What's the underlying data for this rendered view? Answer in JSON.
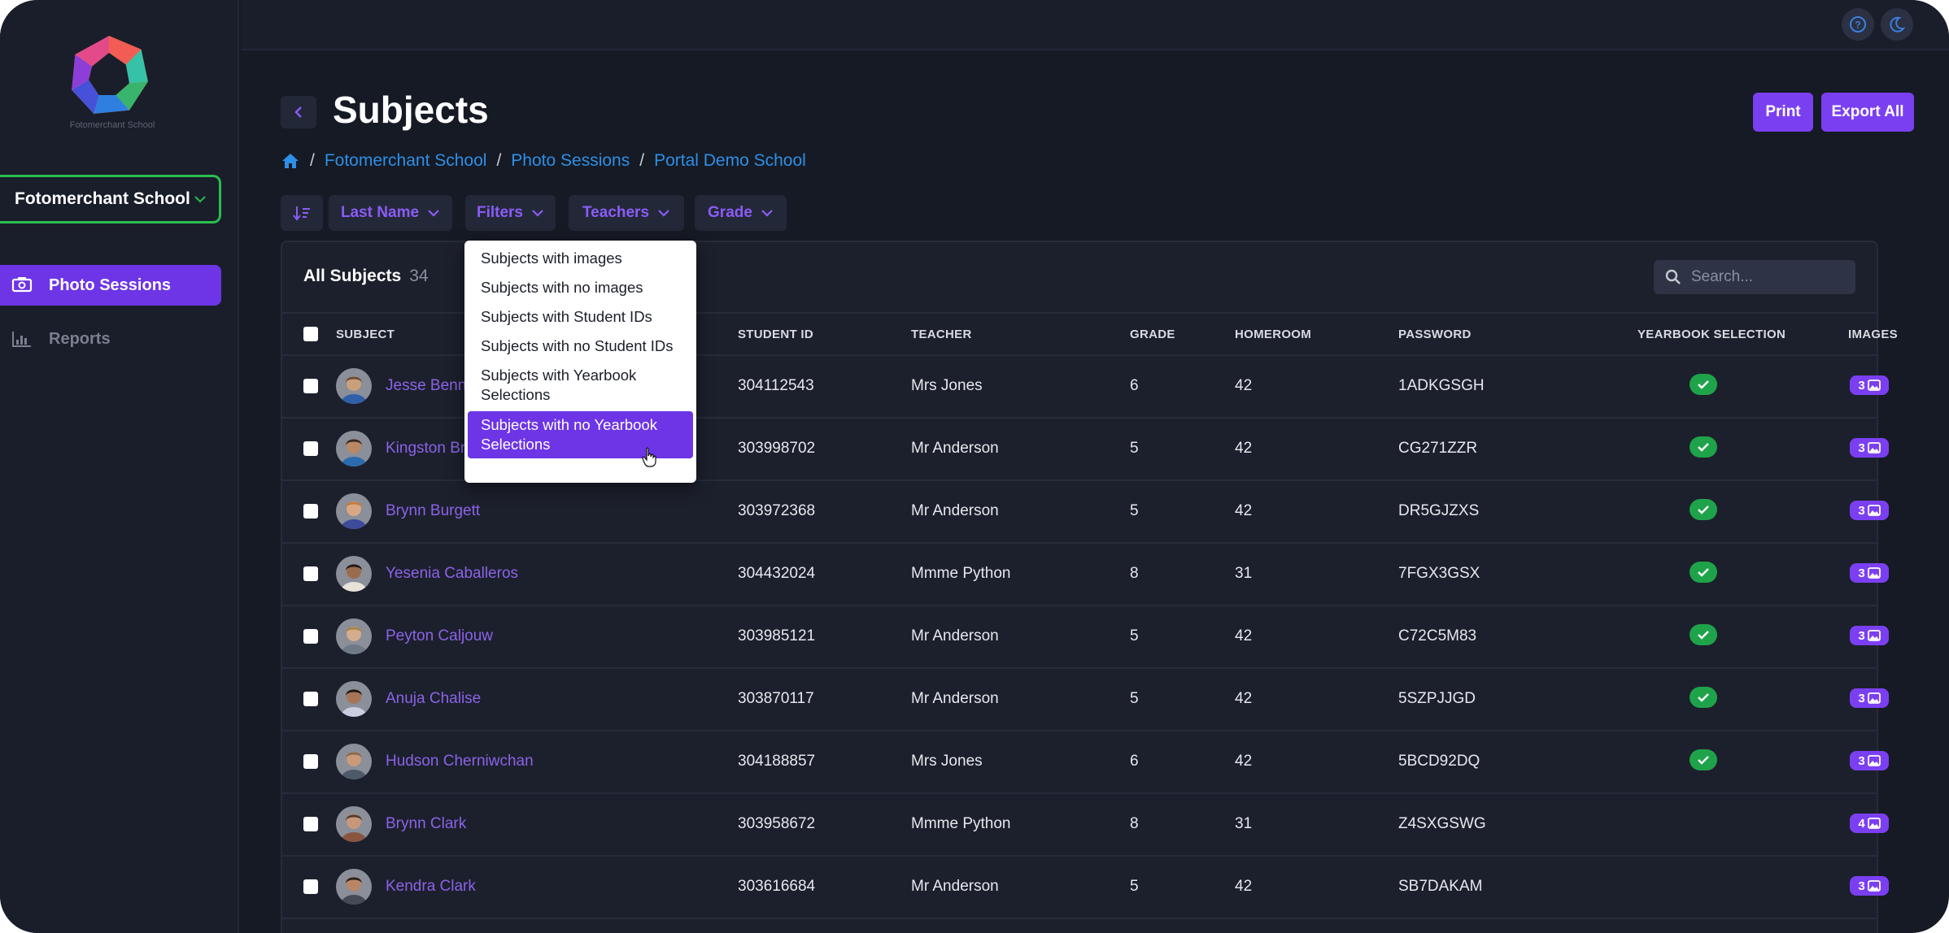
{
  "app": {
    "logo_text": "Fotomerchant School",
    "school_select": "Fotomerchant School"
  },
  "sidebar": {
    "items": [
      {
        "label": "Photo Sessions",
        "icon": "camera-icon",
        "active": true
      },
      {
        "label": "Reports",
        "icon": "bar-chart-icon",
        "active": false
      }
    ]
  },
  "topbar": {
    "help_icon": "help-icon",
    "theme_icon": "moon-icon"
  },
  "header": {
    "title": "Subjects",
    "print_label": "Print",
    "export_label": "Export All"
  },
  "breadcrumb": [
    "Fotomerchant School",
    "Photo Sessions",
    "Portal Demo School"
  ],
  "toolbar": {
    "sort_label": "Last Name",
    "filters_label": "Filters",
    "teachers_label": "Teachers",
    "grade_label": "Grade"
  },
  "filters_menu": [
    "Subjects with images",
    "Subjects with no images",
    "Subjects with Student IDs",
    "Subjects with no Student IDs",
    "Subjects with Yearbook Selections",
    "Subjects with no Yearbook Selections"
  ],
  "table": {
    "title": "All Subjects",
    "count": "34",
    "search_placeholder": "Search...",
    "columns": [
      "SUBJECT",
      "STUDENT ID",
      "TEACHER",
      "GRADE",
      "HOMEROOM",
      "PASSWORD",
      "YEARBOOK SELECTION",
      "IMAGES"
    ],
    "rows": [
      {
        "name": "Jesse Benn",
        "student_id": "304112543",
        "teacher": "Mrs Jones",
        "grade": "6",
        "homeroom": "42",
        "password": "1ADKGSGH",
        "yearbook": true,
        "images": "3"
      },
      {
        "name": "Kingston Br",
        "student_id": "303998702",
        "teacher": "Mr Anderson",
        "grade": "5",
        "homeroom": "42",
        "password": "CG271ZZR",
        "yearbook": true,
        "images": "3"
      },
      {
        "name": "Brynn Burgett",
        "student_id": "303972368",
        "teacher": "Mr Anderson",
        "grade": "5",
        "homeroom": "42",
        "password": "DR5GJZXS",
        "yearbook": true,
        "images": "3"
      },
      {
        "name": "Yesenia Caballeros",
        "student_id": "304432024",
        "teacher": "Mmme Python",
        "grade": "8",
        "homeroom": "31",
        "password": "7FGX3GSX",
        "yearbook": true,
        "images": "3"
      },
      {
        "name": "Peyton Caljouw",
        "student_id": "303985121",
        "teacher": "Mr Anderson",
        "grade": "5",
        "homeroom": "42",
        "password": "C72C5M83",
        "yearbook": true,
        "images": "3"
      },
      {
        "name": "Anuja Chalise",
        "student_id": "303870117",
        "teacher": "Mr Anderson",
        "grade": "5",
        "homeroom": "42",
        "password": "5SZPJJGD",
        "yearbook": true,
        "images": "3"
      },
      {
        "name": "Hudson Cherniwchan",
        "student_id": "304188857",
        "teacher": "Mrs Jones",
        "grade": "6",
        "homeroom": "42",
        "password": "5BCD92DQ",
        "yearbook": true,
        "images": "3"
      },
      {
        "name": "Brynn Clark",
        "student_id": "303958672",
        "teacher": "Mmme Python",
        "grade": "8",
        "homeroom": "31",
        "password": "Z4SXGSWG",
        "yearbook": false,
        "images": "4"
      },
      {
        "name": "Kendra Clark",
        "student_id": "303616684",
        "teacher": "Mr Anderson",
        "grade": "5",
        "homeroom": "42",
        "password": "SB7DAKAM",
        "yearbook": false,
        "images": "3"
      }
    ]
  },
  "colors": {
    "accent": "#7b3ff2",
    "success": "#1fa34a",
    "link": "#2e8fe6",
    "background": "#161a24"
  }
}
